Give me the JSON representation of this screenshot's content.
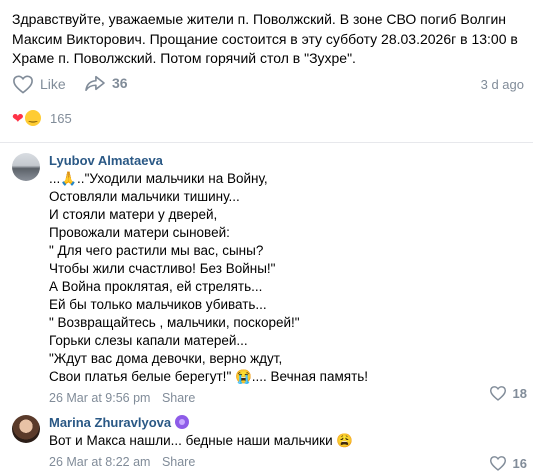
{
  "post": {
    "text": "Здравствуйте, уважаемые жители п. Поволжский. В зоне СВО погиб Волгин Максим Викторович. Прощание состоится в эту субботу 28.03.2026г в 13:00 в Храме п. Поволжский. Потом горячий стол в \"Зухре\".",
    "like_label": "Like",
    "share_count": "36",
    "time": "3 d ago",
    "reactions_count": "165",
    "icons": [
      "heart-outline-icon",
      "share-arrow-icon",
      "heart-reaction-icon",
      "crying-face-reaction-icon"
    ]
  },
  "comments": [
    {
      "author": "Lyubov Almataeva",
      "text": "...🙏..\"Уходили мальчики на Войну,\nОстовляли мальчики тишину...\nИ стояли матери у дверей,\nПровожали матери  сыновей:\n\" Для чего растили мы вас, сыны?\nЧтобы жили счастливо! Без Войны!\"\nА Война проклятая, ей стрелять...\nЕй бы только мальчиков убивать...\n\" Возвращайтесь , мальчики, поскорей!\"\nГорьки слезы капали матерей...\n\"Ждут вас дома девочки, верно ждут,\nСвои платья белые берегут!\" 😭.... Вечная память!",
      "time": "26 Mar at 9:56 pm",
      "share_label": "Share",
      "likes": "18"
    },
    {
      "author": "Marina Zhuravlyova",
      "verified_icon": "verified-badge-icon",
      "text": "Вот и Макса нашли... бедные наши мальчики 😩",
      "time": "26 Mar at 8:22 am",
      "share_label": "Share",
      "likes": "16"
    }
  ],
  "colors": {
    "link": "#2a5885",
    "muted": "#818c99",
    "heart": "#ff3347",
    "divider": "#e7e8ec"
  }
}
